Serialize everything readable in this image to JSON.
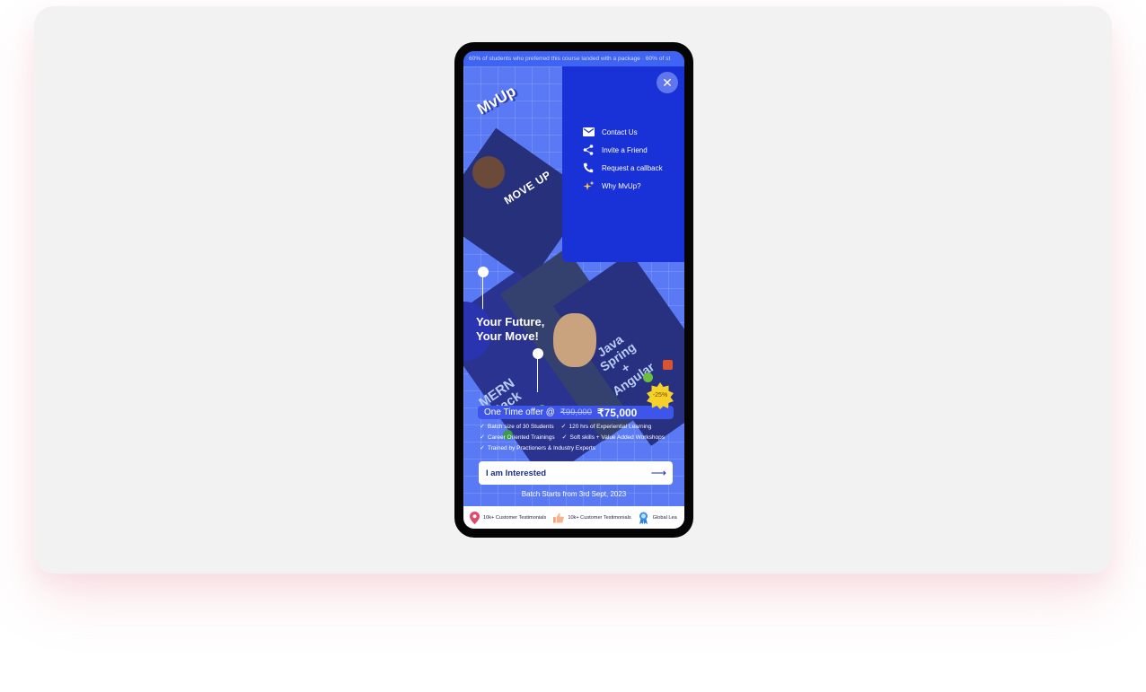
{
  "ticker": {
    "text": "60% of students who preferred this course landed with a package · 60% of st"
  },
  "hero": {
    "logo": "MvUp",
    "move_up": "MOVE UP",
    "tagline": "Your Future,\nYour Move!",
    "mern_title": "MERN\nStack",
    "java_title": "Java\nSpring\n+\nAngular"
  },
  "menu": {
    "close_glyph": "✕",
    "items": [
      {
        "label": "Contact Us",
        "icon": "mail-icon"
      },
      {
        "label": "Invite a Friend",
        "icon": "share-icon"
      },
      {
        "label": "Request a callback",
        "icon": "phone-icon"
      },
      {
        "label": "Why MvUp?",
        "icon": "sparkle-icon"
      }
    ]
  },
  "offer": {
    "label": "One Time offer @",
    "old_price": "₹99,000",
    "new_price": "₹75,000",
    "discount_badge": "-25%"
  },
  "features": [
    "Batch size of 30 Students",
    "120 hrs of Experiential Learning",
    "Career Oriented Trainings",
    "Soft skills + Value Added Workshops",
    "Trained by Practioners & Industry Experts"
  ],
  "cta": {
    "label": "I am Interested",
    "arrow": "⟶"
  },
  "batch_text": "Batch Starts from 3rd Sept, 2023",
  "bottom_bar": {
    "items": [
      {
        "label": "10k+ Customer Testimonials",
        "icon": "map-pin-icon"
      },
      {
        "label": "10k+ Customer Testimonials",
        "icon": "thumbs-up-icon"
      },
      {
        "label": "Global Lea",
        "icon": "award-icon"
      }
    ]
  },
  "colors": {
    "menu_bg": "#1832d8",
    "hero_bg": "#5a7af5",
    "card_bg": "#f2f2f2",
    "badge": "#f6d12a"
  }
}
